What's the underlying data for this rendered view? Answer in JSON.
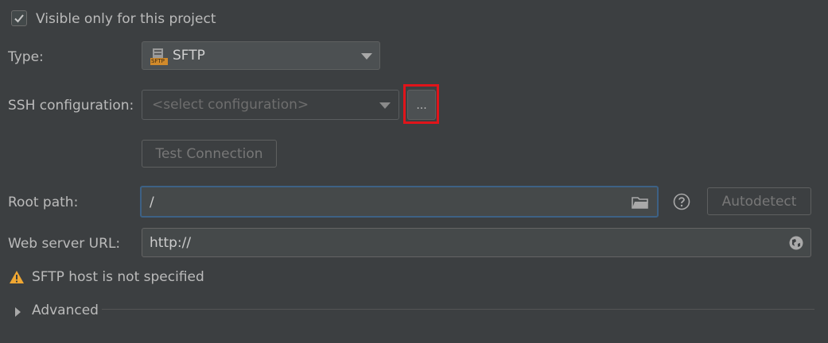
{
  "visible_only": {
    "label": "Visible only for this project",
    "checked": true
  },
  "type": {
    "label": "Type:",
    "value": "SFTP",
    "icon": "sftp-icon",
    "icon_text": "SFTP"
  },
  "ssh": {
    "label": "SSH configuration:",
    "placeholder": "<select configuration>",
    "browse_label": "..."
  },
  "test_connection": {
    "label": "Test Connection"
  },
  "root_path": {
    "label": "Root path:",
    "value": "/",
    "autodetect_label": "Autodetect",
    "help_icon": "help-icon",
    "folder_icon": "folder-icon"
  },
  "web_server": {
    "label": "Web server URL:",
    "value": "http://",
    "globe_icon": "globe-icon"
  },
  "warning": {
    "icon": "warning-icon",
    "text": "SFTP host is not specified"
  },
  "advanced": {
    "label": "Advanced",
    "icon": "triangle-right-icon"
  },
  "colors": {
    "background": "#3c3f41",
    "focus_border": "#3d6185",
    "highlight": "#e0141a",
    "warning": "#f0a732"
  }
}
